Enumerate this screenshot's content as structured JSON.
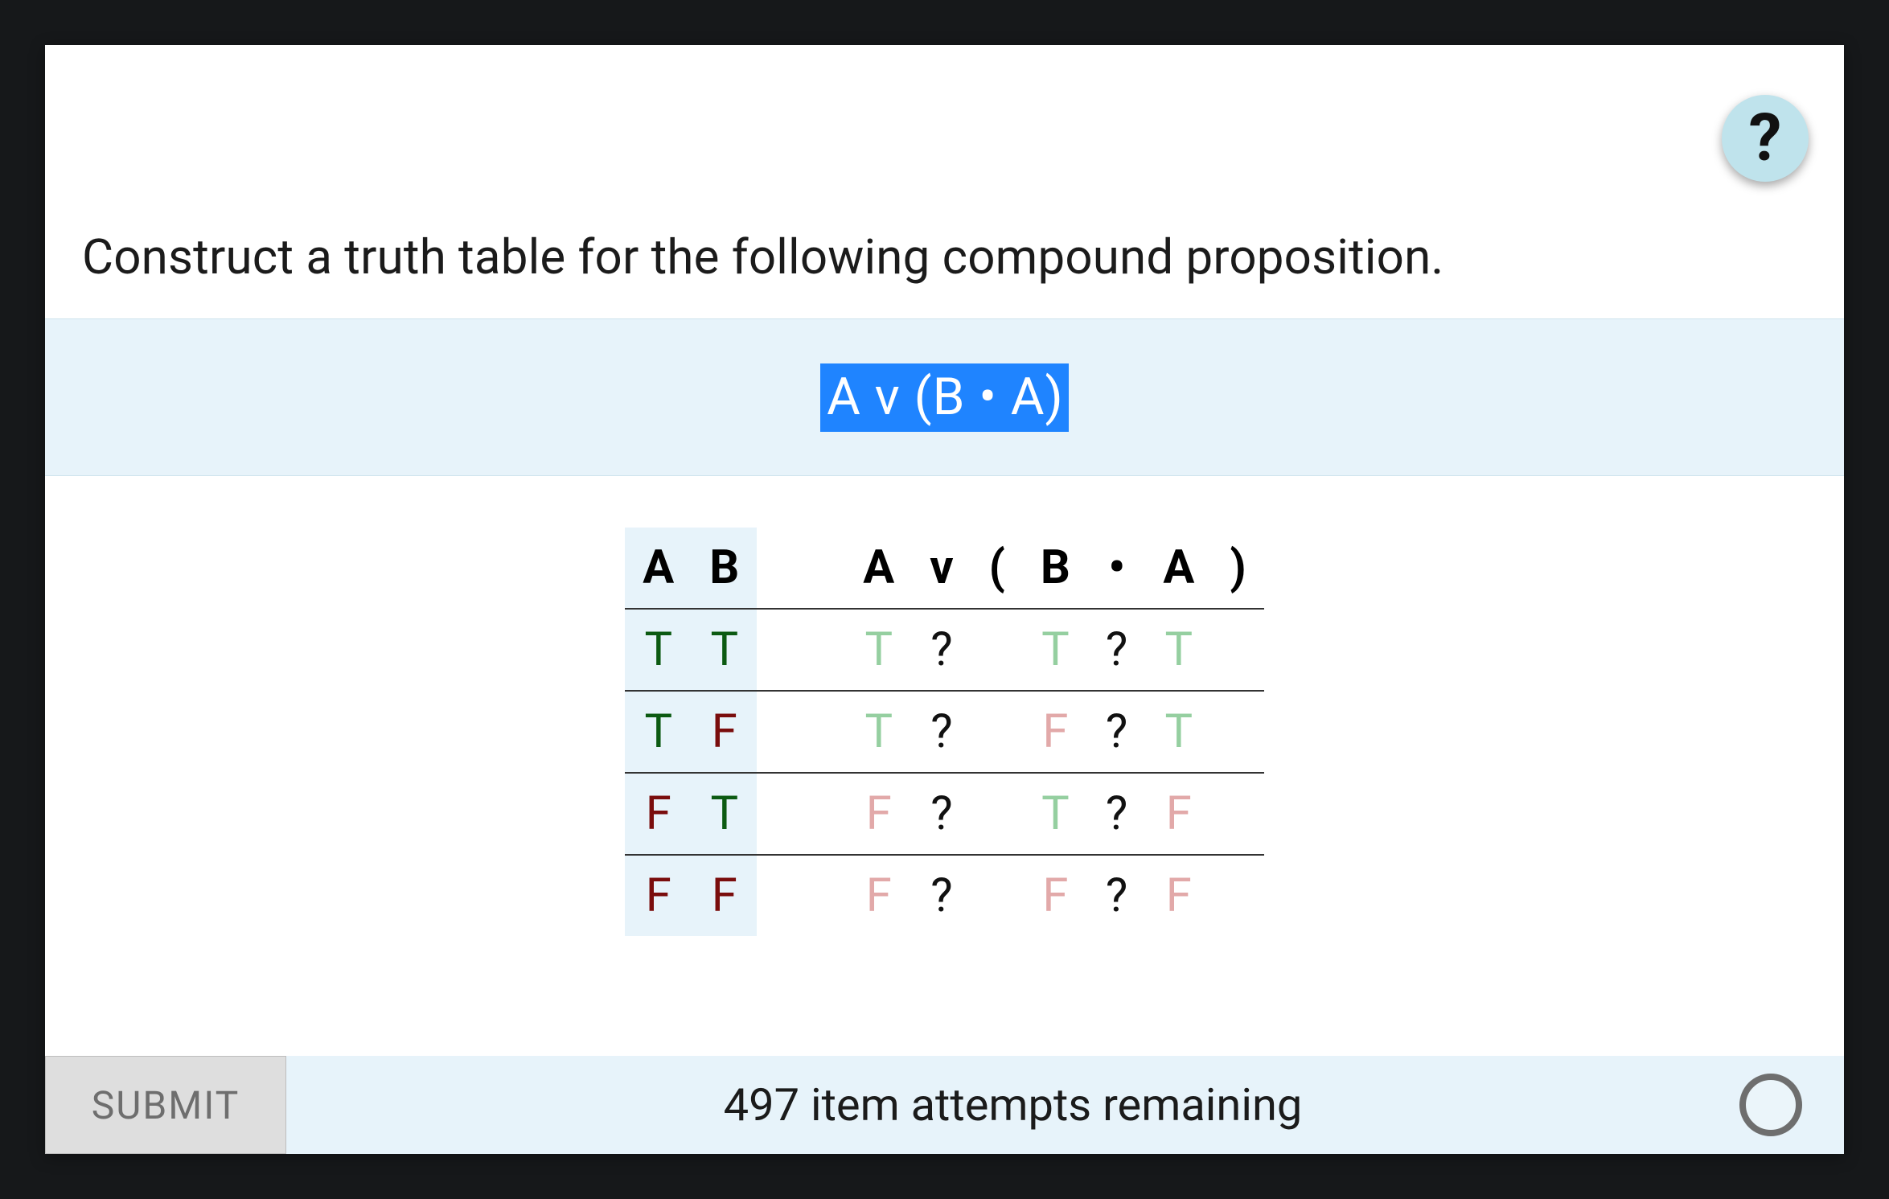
{
  "help_label": "?",
  "prompt": "Construct a truth table for the following compound proposition.",
  "formula_display": "A v (B • A)",
  "table": {
    "var_headers": [
      "A",
      "B"
    ],
    "expr_headers": [
      "A",
      "v",
      "(",
      "B",
      "•",
      "A",
      ")"
    ],
    "rows": [
      {
        "vars": [
          {
            "v": "T",
            "cls": "tv-T-strong"
          },
          {
            "v": "T",
            "cls": "tv-T-strong"
          }
        ],
        "expr": [
          {
            "v": "T",
            "cls": "tv-T-soft"
          },
          {
            "v": "?",
            "cls": "q-mark",
            "interactable": true
          },
          {
            "v": "",
            "cls": ""
          },
          {
            "v": "T",
            "cls": "tv-T-soft"
          },
          {
            "v": "?",
            "cls": "q-mark",
            "interactable": true
          },
          {
            "v": "T",
            "cls": "tv-T-soft"
          },
          {
            "v": "",
            "cls": ""
          }
        ]
      },
      {
        "vars": [
          {
            "v": "T",
            "cls": "tv-T-strong"
          },
          {
            "v": "F",
            "cls": "tv-F-strong"
          }
        ],
        "expr": [
          {
            "v": "T",
            "cls": "tv-T-soft"
          },
          {
            "v": "?",
            "cls": "q-mark",
            "interactable": true
          },
          {
            "v": "",
            "cls": ""
          },
          {
            "v": "F",
            "cls": "tv-F-soft"
          },
          {
            "v": "?",
            "cls": "q-mark",
            "interactable": true
          },
          {
            "v": "T",
            "cls": "tv-T-soft"
          },
          {
            "v": "",
            "cls": ""
          }
        ]
      },
      {
        "vars": [
          {
            "v": "F",
            "cls": "tv-F-strong"
          },
          {
            "v": "T",
            "cls": "tv-T-strong"
          }
        ],
        "expr": [
          {
            "v": "F",
            "cls": "tv-F-soft"
          },
          {
            "v": "?",
            "cls": "q-mark",
            "interactable": true
          },
          {
            "v": "",
            "cls": ""
          },
          {
            "v": "T",
            "cls": "tv-T-soft"
          },
          {
            "v": "?",
            "cls": "q-mark",
            "interactable": true
          },
          {
            "v": "F",
            "cls": "tv-F-soft"
          },
          {
            "v": "",
            "cls": ""
          }
        ]
      },
      {
        "vars": [
          {
            "v": "F",
            "cls": "tv-F-strong"
          },
          {
            "v": "F",
            "cls": "tv-F-strong"
          }
        ],
        "expr": [
          {
            "v": "F",
            "cls": "tv-F-soft"
          },
          {
            "v": "?",
            "cls": "q-mark",
            "interactable": true
          },
          {
            "v": "",
            "cls": ""
          },
          {
            "v": "F",
            "cls": "tv-F-soft"
          },
          {
            "v": "?",
            "cls": "q-mark",
            "interactable": true
          },
          {
            "v": "F",
            "cls": "tv-F-soft"
          },
          {
            "v": "",
            "cls": ""
          }
        ]
      }
    ]
  },
  "footer": {
    "submit_label": "SUBMIT",
    "attempts_text": "497 item attempts remaining"
  }
}
